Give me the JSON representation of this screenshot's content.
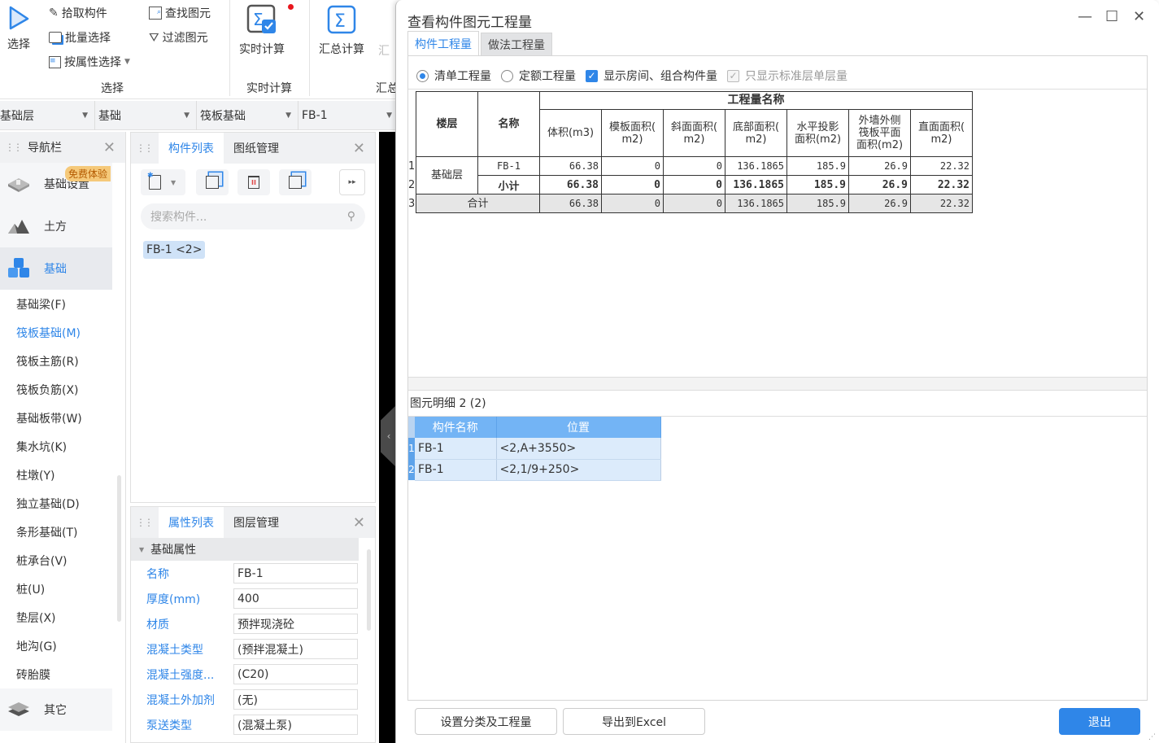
{
  "ribbon": {
    "select_big": "选择",
    "pick_component": "拾取构件",
    "batch_select": "批量选择",
    "select_by_attr": "按属性选择",
    "find_element": "查找图元",
    "filter_element": "过滤图元",
    "group_select": "选择",
    "realtime_calc": "实时计算",
    "group_realtime": "实时计算",
    "summary_calc": "汇总计算",
    "summary_cut": "汇",
    "group_summary": "汇总"
  },
  "crumbs": [
    "基础层",
    "基础",
    "筏板基础",
    "FB-1"
  ],
  "nav": {
    "title": "导航栏",
    "badge": "免费体验",
    "categories": [
      {
        "label": "基础设置",
        "icon": "foundation-settings-icon"
      },
      {
        "label": "土方",
        "icon": "earthwork-icon"
      },
      {
        "label": "基础",
        "icon": "foundation-cubes-icon"
      }
    ],
    "items": [
      "基础梁(F)",
      "筏板基础(M)",
      "筏板主筋(R)",
      "筏板负筋(X)",
      "基础板带(W)",
      "集水坑(K)",
      "柱墩(Y)",
      "独立基础(D)",
      "条形基础(T)",
      "桩承台(V)",
      "桩(U)",
      "垫层(X)",
      "地沟(G)",
      "砖胎膜"
    ],
    "active_item": "筏板基础(M)",
    "other": "其它"
  },
  "complist": {
    "tabs": [
      "构件列表",
      "图纸管理"
    ],
    "search_placeholder": "搜索构件...",
    "chip": "FB-1 <2>"
  },
  "props": {
    "tabs": [
      "属性列表",
      "图层管理"
    ],
    "group": "基础属性",
    "rows": [
      {
        "k": "名称",
        "v": "FB-1"
      },
      {
        "k": "厚度(mm)",
        "v": "400"
      },
      {
        "k": "材质",
        "v": "预拌现浇砼"
      },
      {
        "k": "混凝土类型",
        "v": "(预拌混凝土)"
      },
      {
        "k": "混凝土强度...",
        "v": "(C20)"
      },
      {
        "k": "混凝土外加剂",
        "v": "(无)"
      },
      {
        "k": "泵送类型",
        "v": "(混凝土泵)"
      }
    ]
  },
  "dialog": {
    "title": "查看构件图元工程量",
    "tabs": [
      "构件工程量",
      "做法工程量"
    ],
    "options": {
      "bill_qty": "清单工程量",
      "quota_qty": "定额工程量",
      "show_room": "显示房间、组合构件量",
      "std_floor_only": "只显示标准层单层量"
    },
    "table": {
      "col_floor": "楼层",
      "col_name": "名称",
      "group_header": "工程量名称",
      "qty_headers": [
        "体积(m3)",
        "模板面积(m2)",
        "斜面面积(m2)",
        "底部面积(m2)",
        "水平投影面积(m2)",
        "外墙外侧筏板平面面积(m2)",
        "直面面积(m2)"
      ],
      "qty_headers_display": [
        "体积(m3)",
        "模板面积(\nm2)",
        "斜面面积(\nm2)",
        "底部面积(\nm2)",
        "水平投影\n面积(m2)",
        "外墙外侧\n筏板平面\n面积(m2)",
        "直面面积(\nm2)"
      ],
      "floor": "基础层",
      "rows": [
        {
          "num": "1",
          "name": "FB-1",
          "values": [
            "66.38",
            "0",
            "0",
            "136.1865",
            "185.9",
            "26.9",
            "22.32"
          ]
        },
        {
          "num": "2",
          "name": "小计",
          "values": [
            "66.38",
            "0",
            "0",
            "136.1865",
            "185.9",
            "26.9",
            "22.32"
          ]
        },
        {
          "num": "3",
          "name": "合计",
          "values": [
            "66.38",
            "0",
            "0",
            "136.1865",
            "185.9",
            "26.9",
            "22.32"
          ]
        }
      ]
    },
    "detail": {
      "title": "图元明细  2 (2)",
      "headers": [
        "构件名称",
        "位置"
      ],
      "rows": [
        {
          "num": "1",
          "name": "FB-1",
          "pos": "<2,A+3550>"
        },
        {
          "num": "2",
          "name": "FB-1",
          "pos": "<2,1/9+250>"
        }
      ]
    },
    "buttons": {
      "set_category": "设置分类及工程量",
      "export_excel": "导出到Excel",
      "exit": "退出"
    }
  }
}
